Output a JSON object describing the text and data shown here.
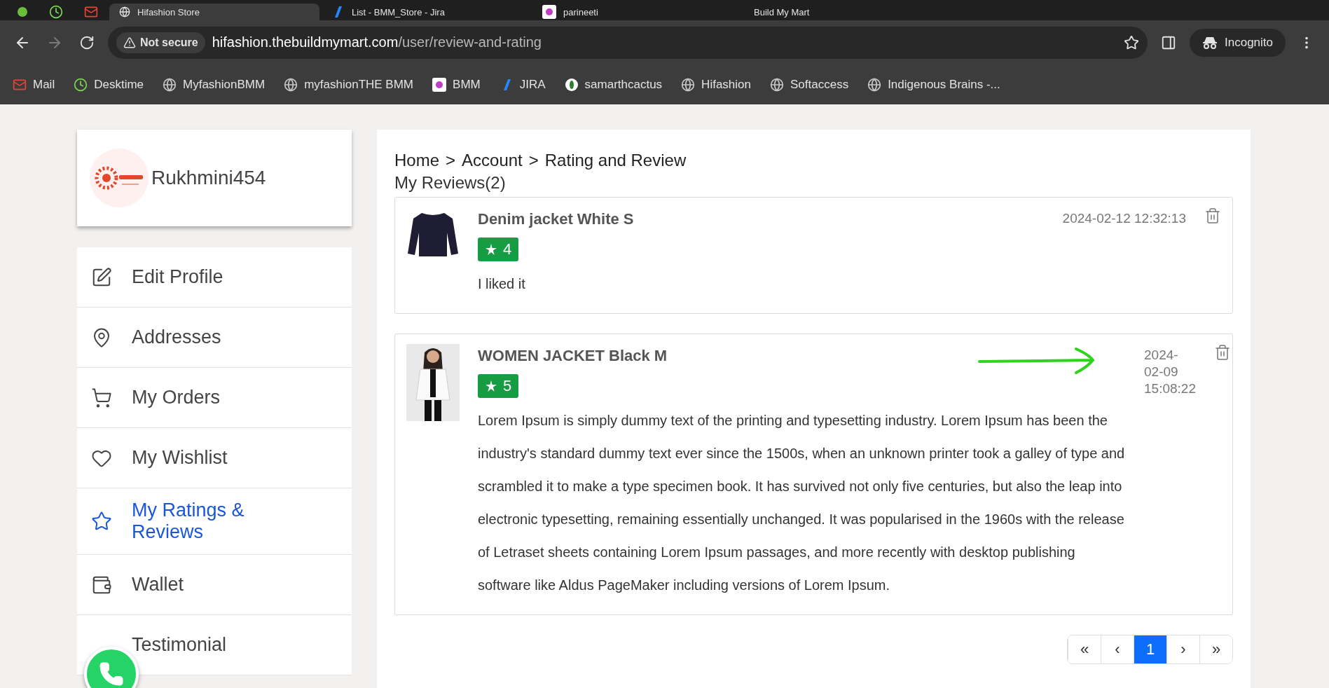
{
  "browser": {
    "tabs": [
      {
        "kind": "round",
        "selected": false
      },
      {
        "kind": "clock",
        "selected": false
      },
      {
        "kind": "mail",
        "selected": false
      },
      {
        "kind": "globe",
        "title": "Hifashion Store",
        "selected": true
      },
      {
        "kind": "jira",
        "title": "List - BMM_Store - Jira",
        "selected": false
      },
      {
        "kind": "logo",
        "title": "parineeti",
        "selected": false
      },
      {
        "kind": "blank",
        "title": "Build My Mart",
        "selected": false
      }
    ],
    "security": "Not secure",
    "url_host": "hifashion.thebuildmymart.com",
    "url_path": "/user/review-and-rating",
    "profile": "Incognito",
    "bookmarks": [
      {
        "kind": "mail",
        "label": "Mail"
      },
      {
        "kind": "clock",
        "label": "Desktime"
      },
      {
        "kind": "globe",
        "label": "MyfashionBMM"
      },
      {
        "kind": "globe",
        "label": "myfashionTHE BMM"
      },
      {
        "kind": "logo",
        "label": "BMM"
      },
      {
        "kind": "jira",
        "label": "JIRA"
      },
      {
        "kind": "ring",
        "label": "samarthcactus"
      },
      {
        "kind": "globe",
        "label": "Hifashion"
      },
      {
        "kind": "globe",
        "label": "Softaccess"
      },
      {
        "kind": "globe",
        "label": "Indigenous Brains -..."
      }
    ]
  },
  "profile": {
    "username": "Rukhmini454"
  },
  "menu": [
    {
      "kind": "edit",
      "label": "Edit Profile",
      "selected": false
    },
    {
      "kind": "pin",
      "label": "Addresses",
      "selected": false
    },
    {
      "kind": "cart",
      "label": "My Orders",
      "selected": false
    },
    {
      "kind": "heart",
      "label": "My Wishlist",
      "selected": false
    },
    {
      "kind": "star",
      "label": "My Ratings & Reviews",
      "selected": true
    },
    {
      "kind": "wallet",
      "label": "Wallet",
      "selected": false
    },
    {
      "kind": "plain",
      "label": "Testimonial",
      "selected": false
    }
  ],
  "breadcrumb": {
    "items": [
      "Home",
      "Account",
      "Rating and Review"
    ],
    "separator": ">"
  },
  "heading": "My Reviews(2)",
  "reviews": [
    {
      "kind": "sweater",
      "product": "Denim jacket White S",
      "rating": "4",
      "text": "I liked it",
      "date": "2024-02-12 12:32:13",
      "arrow": false
    },
    {
      "kind": "figure",
      "product": "WOMEN JACKET Black M",
      "rating": "5",
      "text": "Lorem Ipsum is simply dummy text of the printing and typesetting industry. Lorem Ipsum has been the industry's standard dummy text ever since the 1500s, when an unknown printer took a galley of type and scrambled it to make a type specimen book. It has survived not only five centuries, but also the leap into electronic typesetting, remaining essentially unchanged. It was popularised in the 1960s with the release of Letraset sheets containing Lorem Ipsum passages, and more recently with desktop publishing software like Aldus PageMaker including versions of Lorem Ipsum.",
      "date": "2024-02-09 15:08:22",
      "arrow": true
    }
  ],
  "pagination": [
    {
      "label": "«",
      "selected": false
    },
    {
      "label": "‹",
      "selected": false
    },
    {
      "label": "1",
      "selected": true
    },
    {
      "label": "›",
      "selected": false
    },
    {
      "label": "»",
      "selected": false
    }
  ]
}
